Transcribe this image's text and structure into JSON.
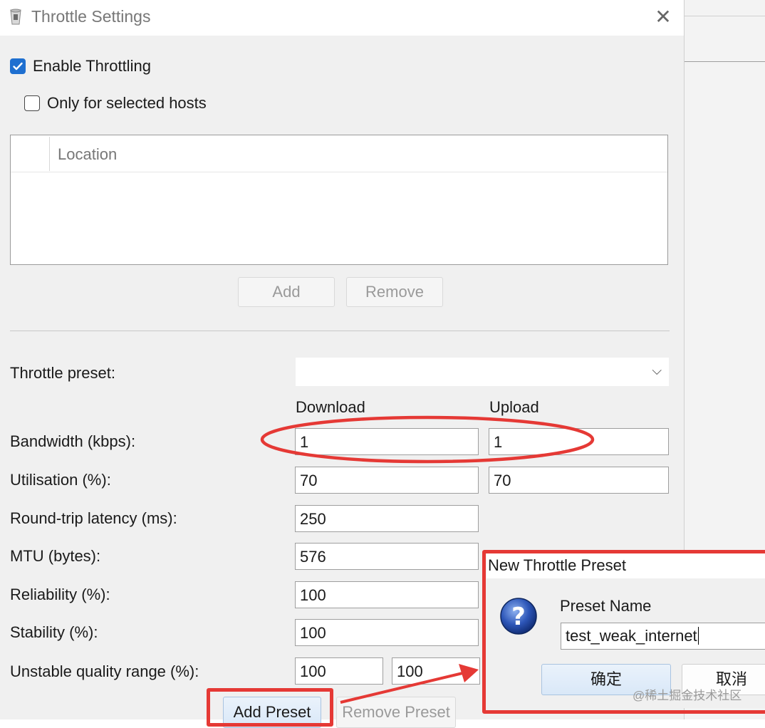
{
  "window": {
    "title": "Throttle Settings",
    "close_symbol": "✕",
    "icon": "app-icon"
  },
  "checkboxes": {
    "enable_throttling": {
      "label": "Enable Throttling",
      "checked": true
    },
    "only_selected_hosts": {
      "label": "Only for selected hosts",
      "checked": false
    }
  },
  "hosts_table": {
    "columns": [
      "Location"
    ],
    "rows": []
  },
  "host_buttons": {
    "add": "Add",
    "remove": "Remove"
  },
  "preset": {
    "label": "Throttle preset:",
    "selected": ""
  },
  "columns": {
    "download": "Download",
    "upload": "Upload"
  },
  "fields": {
    "bandwidth": {
      "label": "Bandwidth (kbps):",
      "download": "1",
      "upload": "1"
    },
    "utilisation": {
      "label": "Utilisation (%):",
      "download": "70",
      "upload": "70"
    },
    "latency": {
      "label": "Round-trip latency (ms):",
      "value": "250"
    },
    "mtu": {
      "label": "MTU (bytes):",
      "value": "576"
    },
    "reliability": {
      "label": "Reliability (%):",
      "value": "100"
    },
    "stability": {
      "label": "Stability (%):",
      "value": "100"
    },
    "unstable_range": {
      "label": "Unstable quality range (%):",
      "min": "100",
      "max": "100"
    }
  },
  "preset_buttons": {
    "add": "Add Preset",
    "remove": "Remove Preset"
  },
  "popup": {
    "title": "New Throttle Preset",
    "icon": "question-icon",
    "name_label": "Preset Name",
    "name_value": "test_weak_internet",
    "confirm": "确定",
    "cancel": "取消"
  },
  "watermark": "@稀土掘金技术社区",
  "colors": {
    "accent": "#1e6fd0",
    "annotation_red": "#e53935",
    "dialog_bg": "#f0f0f0"
  }
}
